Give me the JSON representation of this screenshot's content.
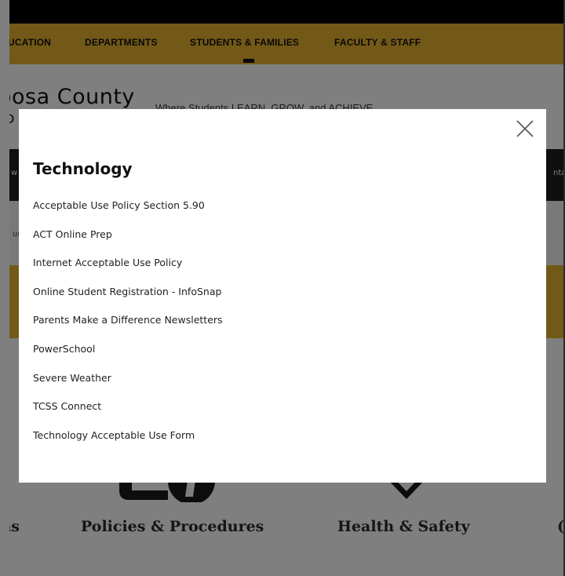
{
  "nav": {
    "items": [
      {
        "label": "UCATION"
      },
      {
        "label": "DEPARTMENTS"
      },
      {
        "label": "STUDENTS & FAMILIES"
      },
      {
        "label": "FACULTY & STAFF"
      }
    ]
  },
  "header": {
    "brand": "oosa County",
    "brand_sub": "D",
    "tagline": "Where Students LEARN, GROW, and ACHIEVE"
  },
  "background": {
    "band_left_text": "w",
    "band_right_text": "nta",
    "strip_left_text": "ur",
    "cards": [
      {
        "label": "as"
      },
      {
        "label": "Policies & Procedures"
      },
      {
        "label": "Health & Safety"
      },
      {
        "label": "("
      }
    ]
  },
  "modal": {
    "title": "Technology",
    "close_icon": "close-icon",
    "links": [
      {
        "label": "Acceptable Use Policy Section 5.90"
      },
      {
        "label": "ACT Online Prep"
      },
      {
        "label": "Internet Acceptable Use Policy"
      },
      {
        "label": "Online Student Registration - InfoSnap"
      },
      {
        "label": "Parents Make a Difference Newsletters"
      },
      {
        "label": "PowerSchool"
      },
      {
        "label": "Severe Weather"
      },
      {
        "label": "TCSS Connect"
      },
      {
        "label": "Technology Acceptable Use Form"
      }
    ]
  },
  "colors": {
    "accent_gold": "#e7b22f",
    "dark_band": "#1f1f1f",
    "overlay": "rgba(0,0,0,0.5)"
  }
}
